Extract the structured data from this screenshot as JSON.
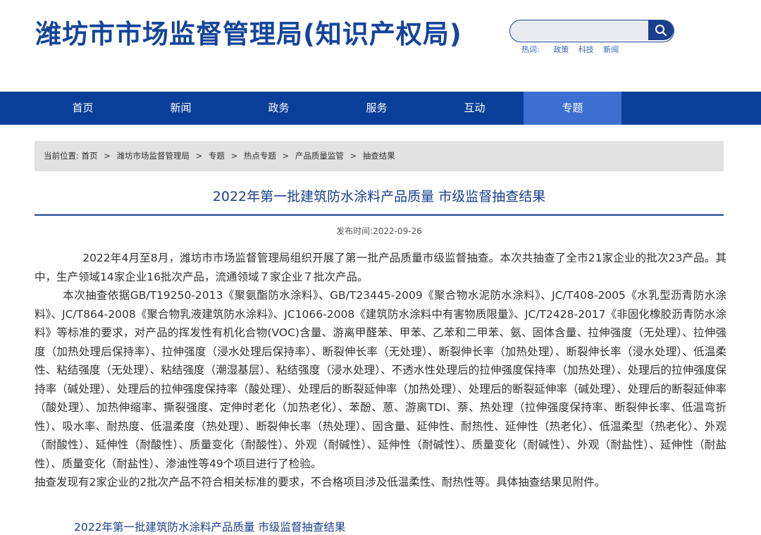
{
  "header": {
    "site_title": "潍坊市市场监督管理局(知识产权局)",
    "search": {
      "placeholder": "",
      "value": ""
    },
    "hot_words": {
      "label": "热词:",
      "items": [
        "政策",
        "科技",
        "新闻"
      ]
    }
  },
  "nav": {
    "items": [
      "首页",
      "新闻",
      "政务",
      "服务",
      "互动",
      "专题"
    ],
    "active_index": 5
  },
  "breadcrumb": {
    "label": "当前位置:",
    "items": [
      "首页",
      "潍坊市场监督管理局",
      "专题",
      "热点专题",
      "产品质量监管",
      "抽查结果"
    ],
    "separator": ">"
  },
  "article": {
    "title": "2022年第一批建筑防水涂料产品质量 市级监督抽查结果",
    "publish_label": "发布时间:",
    "publish_date": "2022-09-26",
    "paragraphs": [
      "2022年4月至8月，潍坊市市场监督管理局组织开展了第一批产品质量市级监督抽查。本次共抽查了全市21家企业的批次23产品。其中，生产领域14家企业16批次产品，流通领域７家企业７批次产品。",
      "本次抽查依据GB/T19250-2013《聚氨酯防水涂料》、GB/T23445-2009《聚合物水泥防水涂料》、JC/T408-2005《水乳型沥青防水涂料》、JC/T864-2008《聚合物乳液建筑防水涂料》、JC1066-2008《建筑防水涂料中有害物质限量》、JC/T2428-2017《非固化橡胶沥青防水涂料》等标准的要求，对产品的挥发性有机化合物(VOC)含量、游离甲醛苯、甲苯、乙苯和二甲苯、氨、固体含量、拉伸强度（无处理）、拉伸强度（加热处理后保持率）、拉伸强度（浸水处理后保持率）、断裂伸长率（无处理）、断裂伸长率（加热处理）、断裂伸长率（浸水处理）、低温柔性、粘结强度（无处理）、粘结强度（潮湿基层）、粘结强度（浸水处理）、不透水性处理后的拉伸强度保持率（加热处理）、处理后的拉伸强度保持率（碱处理）、处理后的拉伸强度保持率（酸处理）、处理后的断裂延伸率（加热处理）、处理后的断裂延伸率（碱处理）、处理后的断裂延伸率（酸处理）、加热伸缩率、撕裂强度、定伸时老化（加热老化）、苯酚、蒽、游离TDI、萘、热处理（拉伸强度保持率、断裂伸长率、低温弯折性）、吸水率、耐热度、低温柔度（热处理）、断裂伸长率（热处理）、固含量、延伸性、耐热性、延伸性（热老化）、低温柔型（热老化）、外观（耐酸性）、延伸性（耐酸性）、质量变化（耐酸性）、外观（耐碱性）、延伸性（耐碱性）、质量变化（耐碱性）、外观（耐盐性）、延伸性（耐盐性）、质量变化（耐盐性）、渗油性等49个项目进行了检验。",
      "抽查发现有2家企业的2批次产品不符合相关标准的要求，不合格项目涉及低温柔性、耐热性等。具体抽查结果见附件。"
    ],
    "attachment_link": "2022年第一批建筑防水涂料产品质量 市级监督抽查结果"
  },
  "colors": {
    "brand_blue": "#14459b",
    "nav_bg": "#0a3f99",
    "nav_active": "#3c6fd0",
    "breadcrumb_bg": "#e2e2e2"
  }
}
